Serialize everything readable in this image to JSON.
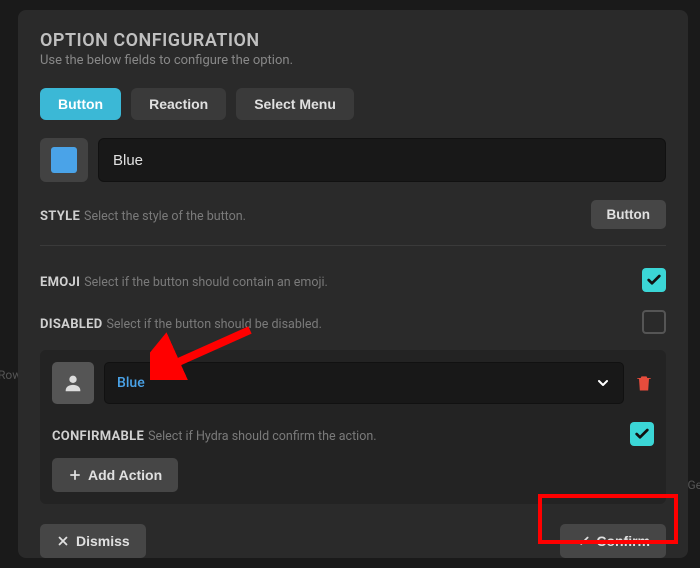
{
  "header": {
    "title": "OPTION CONFIGURATION",
    "subtitle": "Use the below fields to configure the option."
  },
  "typeTabs": {
    "button": "Button",
    "reaction": "Reaction",
    "selectMenu": "Select Menu",
    "active": "button"
  },
  "nameInput": {
    "value": "Blue",
    "chipColor": "#4aa3e8"
  },
  "style": {
    "label": "STYLE",
    "desc": "Select the style of the button.",
    "buttonLabel": "Button"
  },
  "emoji": {
    "label": "EMOJI",
    "desc": "Select if the button should contain an emoji.",
    "checked": true
  },
  "disabled": {
    "label": "DISABLED",
    "desc": "Select if the button should be disabled.",
    "checked": false
  },
  "action": {
    "roleSelect": {
      "value": "Blue"
    },
    "confirmable": {
      "label": "CONFIRMABLE",
      "desc": "Select if Hydra should confirm the action.",
      "checked": true
    }
  },
  "addAction": {
    "label": "Add Action"
  },
  "footer": {
    "dismiss": "Dismiss",
    "confirm": "Confirm"
  },
  "behindText": {
    "row": "Row",
    "ge": "Ge"
  }
}
